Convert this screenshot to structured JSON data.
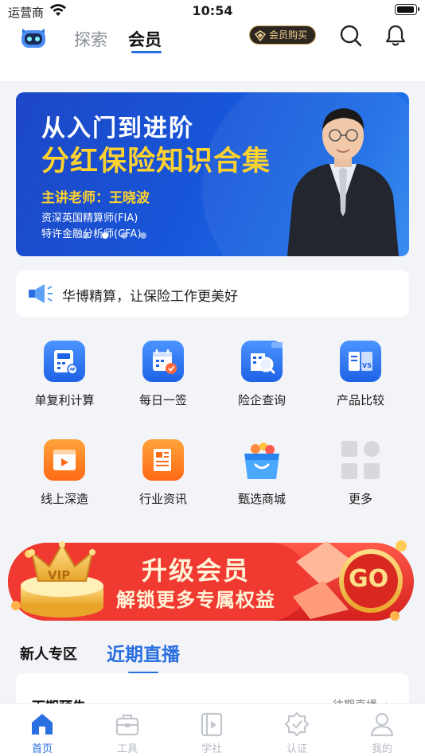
{
  "status_bar": {
    "carrier": "运营商",
    "time": "10:54"
  },
  "top_nav": {
    "tabs": [
      {
        "label": "探索"
      },
      {
        "label": "会员"
      }
    ],
    "buy_badge": "会员购买"
  },
  "banner": {
    "title_line1": "从入门到进阶",
    "title_line2": "分红保险知识合集",
    "teacher": "主讲老师：王晓波",
    "cred1": "资深英国精算师(FIA)",
    "cred2": "特许金融分析师(CFA)",
    "page_count": 4,
    "active_page": 1
  },
  "notice": {
    "text": "华博精算，让保险工作更美好"
  },
  "grid": [
    {
      "label": "单复利计算",
      "icon": "calculator-icon"
    },
    {
      "label": "每日一签",
      "icon": "calendar-check-icon"
    },
    {
      "label": "险企查询",
      "icon": "company-search-icon"
    },
    {
      "label": "产品比较",
      "icon": "compare-icon"
    },
    {
      "label": "线上深造",
      "icon": "video-play-icon"
    },
    {
      "label": "行业资讯",
      "icon": "news-icon"
    },
    {
      "label": "甄选商城",
      "icon": "shopping-bag-icon"
    },
    {
      "label": "更多",
      "icon": "more-grid-icon"
    }
  ],
  "vip_banner": {
    "line1": "升级会员",
    "line2": "解锁更多专属权益",
    "go": "GO",
    "vip_tag": "VIP"
  },
  "section": {
    "tabs": [
      {
        "label": "新人专区"
      },
      {
        "label": "近期直播"
      }
    ],
    "card_title": "下期预告",
    "card_more": "往期直播"
  },
  "tabbar": [
    {
      "label": "首页",
      "active": true
    },
    {
      "label": "工具"
    },
    {
      "label": "学社"
    },
    {
      "label": "认证"
    },
    {
      "label": "我的"
    }
  ],
  "colors": {
    "accent": "#2a6fe0",
    "banner_gold": "#ffd22e",
    "vip_red": "#e5332e"
  }
}
